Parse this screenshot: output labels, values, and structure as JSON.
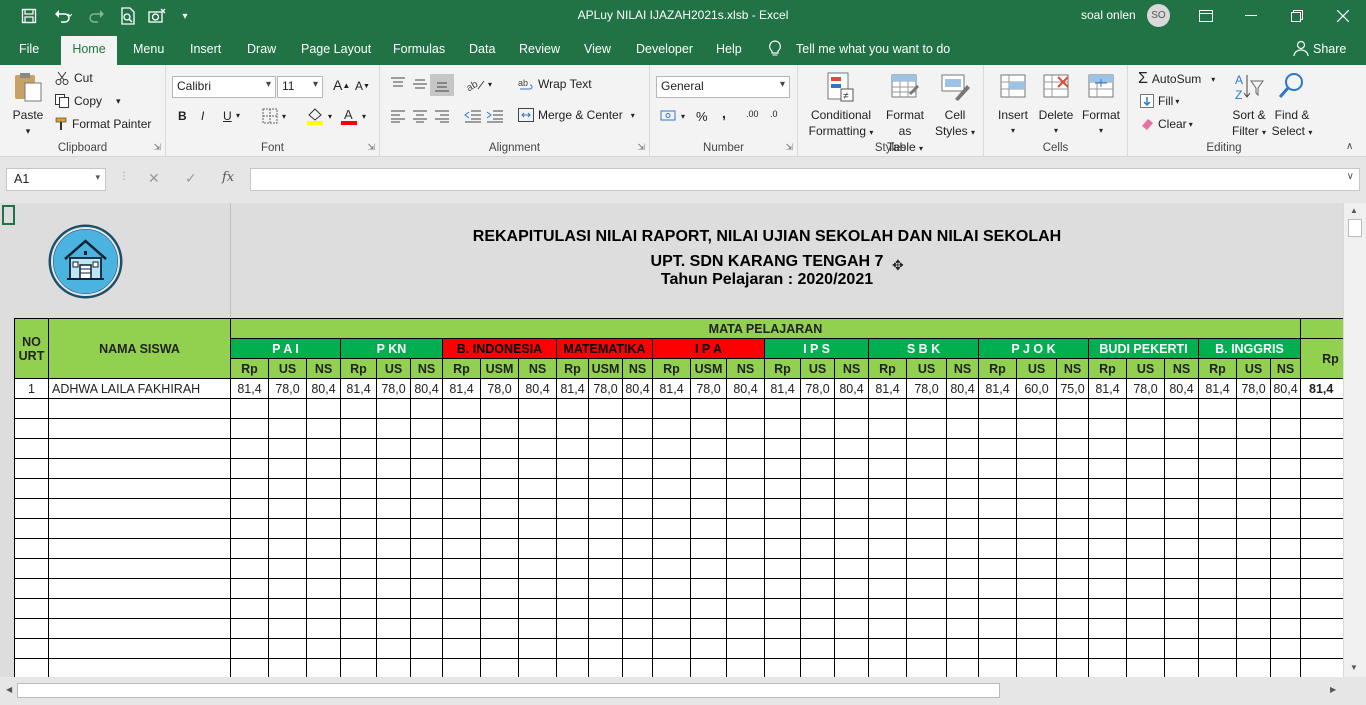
{
  "title_bar": {
    "document_title": "APLuy NILAI IJAZAH2021s.xlsb  -  Excel",
    "user_name": "soal onlen",
    "user_initials": "SO"
  },
  "menu": {
    "file": "File",
    "home": "Home",
    "items": [
      "Menu",
      "Insert",
      "Draw",
      "Page Layout",
      "Formulas",
      "Data",
      "Review",
      "View",
      "Developer",
      "Help"
    ],
    "tell_me": "Tell me what you want to do",
    "share": "Share"
  },
  "ribbon": {
    "clipboard": {
      "label": "Clipboard",
      "paste": "Paste",
      "cut": "Cut",
      "copy": "Copy",
      "format_painter": "Format Painter"
    },
    "font": {
      "label": "Font",
      "font_name": "Calibri",
      "font_size": "11",
      "bold": "B",
      "italic": "I",
      "underline": "U"
    },
    "alignment": {
      "label": "Alignment",
      "wrap_text": "Wrap Text",
      "merge_center": "Merge & Center"
    },
    "number": {
      "label": "Number",
      "format": "General",
      "percent": "%",
      "comma": ",",
      "inc_dec": ".00",
      "dec_dec": ".0"
    },
    "styles": {
      "label": "Styles",
      "conditional_1": "Conditional",
      "conditional_2": "Formatting",
      "format_table_1": "Format as",
      "format_table_2": "Table",
      "cell_styles_1": "Cell",
      "cell_styles_2": "Styles"
    },
    "cells": {
      "label": "Cells",
      "insert": "Insert",
      "delete": "Delete",
      "format": "Format"
    },
    "editing": {
      "label": "Editing",
      "autosum": "AutoSum",
      "fill": "Fill",
      "clear": "Clear",
      "sort_1": "Sort &",
      "sort_2": "Filter",
      "find_1": "Find &",
      "find_2": "Select"
    }
  },
  "formula_bar": {
    "name_box": "A1",
    "fx": "fx",
    "formula": ""
  },
  "sheet": {
    "title_line1": "REKAPITULASI NILAI RAPORT, NILAI UJIAN SEKOLAH DAN NILAI SEKOLAH",
    "title_line2": "UPT. SDN KARANG TENGAH 7",
    "title_line3": "Tahun Pelajaran : 2020/2021",
    "no_urut": "NO\nURT",
    "nama_siswa": "NAMA SISWA",
    "mata_pelajaran": "MATA PELAJARAN",
    "subjects": [
      {
        "name": "P A I",
        "cols": [
          "Rp",
          "US",
          "NS"
        ],
        "style": "dg"
      },
      {
        "name": "P KN",
        "cols": [
          "Rp",
          "US",
          "NS"
        ],
        "style": "dg"
      },
      {
        "name": "B. INDONESIA",
        "cols": [
          "Rp",
          "USM",
          "NS"
        ],
        "style": "rd"
      },
      {
        "name": "MATEMATIKA",
        "cols": [
          "Rp",
          "USM",
          "NS"
        ],
        "style": "rd"
      },
      {
        "name": "I P A",
        "cols": [
          "Rp",
          "USM",
          "NS"
        ],
        "style": "rd"
      },
      {
        "name": "I P S",
        "cols": [
          "Rp",
          "US",
          "NS"
        ],
        "style": "dg"
      },
      {
        "name": "S B K",
        "cols": [
          "Rp",
          "US",
          "NS"
        ],
        "style": "dg"
      },
      {
        "name": "P J O K",
        "cols": [
          "Rp",
          "US",
          "NS"
        ],
        "style": "dg"
      },
      {
        "name": "BUDI PEKERTI",
        "cols": [
          "Rp",
          "US",
          "NS"
        ],
        "style": "dg"
      },
      {
        "name": "B. INGGRIS",
        "cols": [
          "Rp",
          "US",
          "NS"
        ],
        "style": "dg"
      }
    ],
    "last_col_header": "Rp",
    "rows": [
      {
        "no": "1",
        "nama": "ADHWA LAILA FAKHIRAH",
        "values": [
          "81,4",
          "78,0",
          "80,4",
          "81,4",
          "78,0",
          "80,4",
          "81,4",
          "78,0",
          "80,4",
          "81,4",
          "78,0",
          "80,4",
          "81,4",
          "78,0",
          "80,4",
          "81,4",
          "78,0",
          "80,4",
          "81,4",
          "78,0",
          "80,4",
          "81,4",
          "60,0",
          "75,0",
          "81,4",
          "78,0",
          "80,4",
          "81,4",
          "78,0",
          "80,4"
        ],
        "last": "81,4"
      }
    ]
  },
  "colors": {
    "excel_green": "#217346",
    "header_light_green": "#92d050",
    "header_dark_green": "#00b050",
    "header_red": "#ff0000"
  }
}
